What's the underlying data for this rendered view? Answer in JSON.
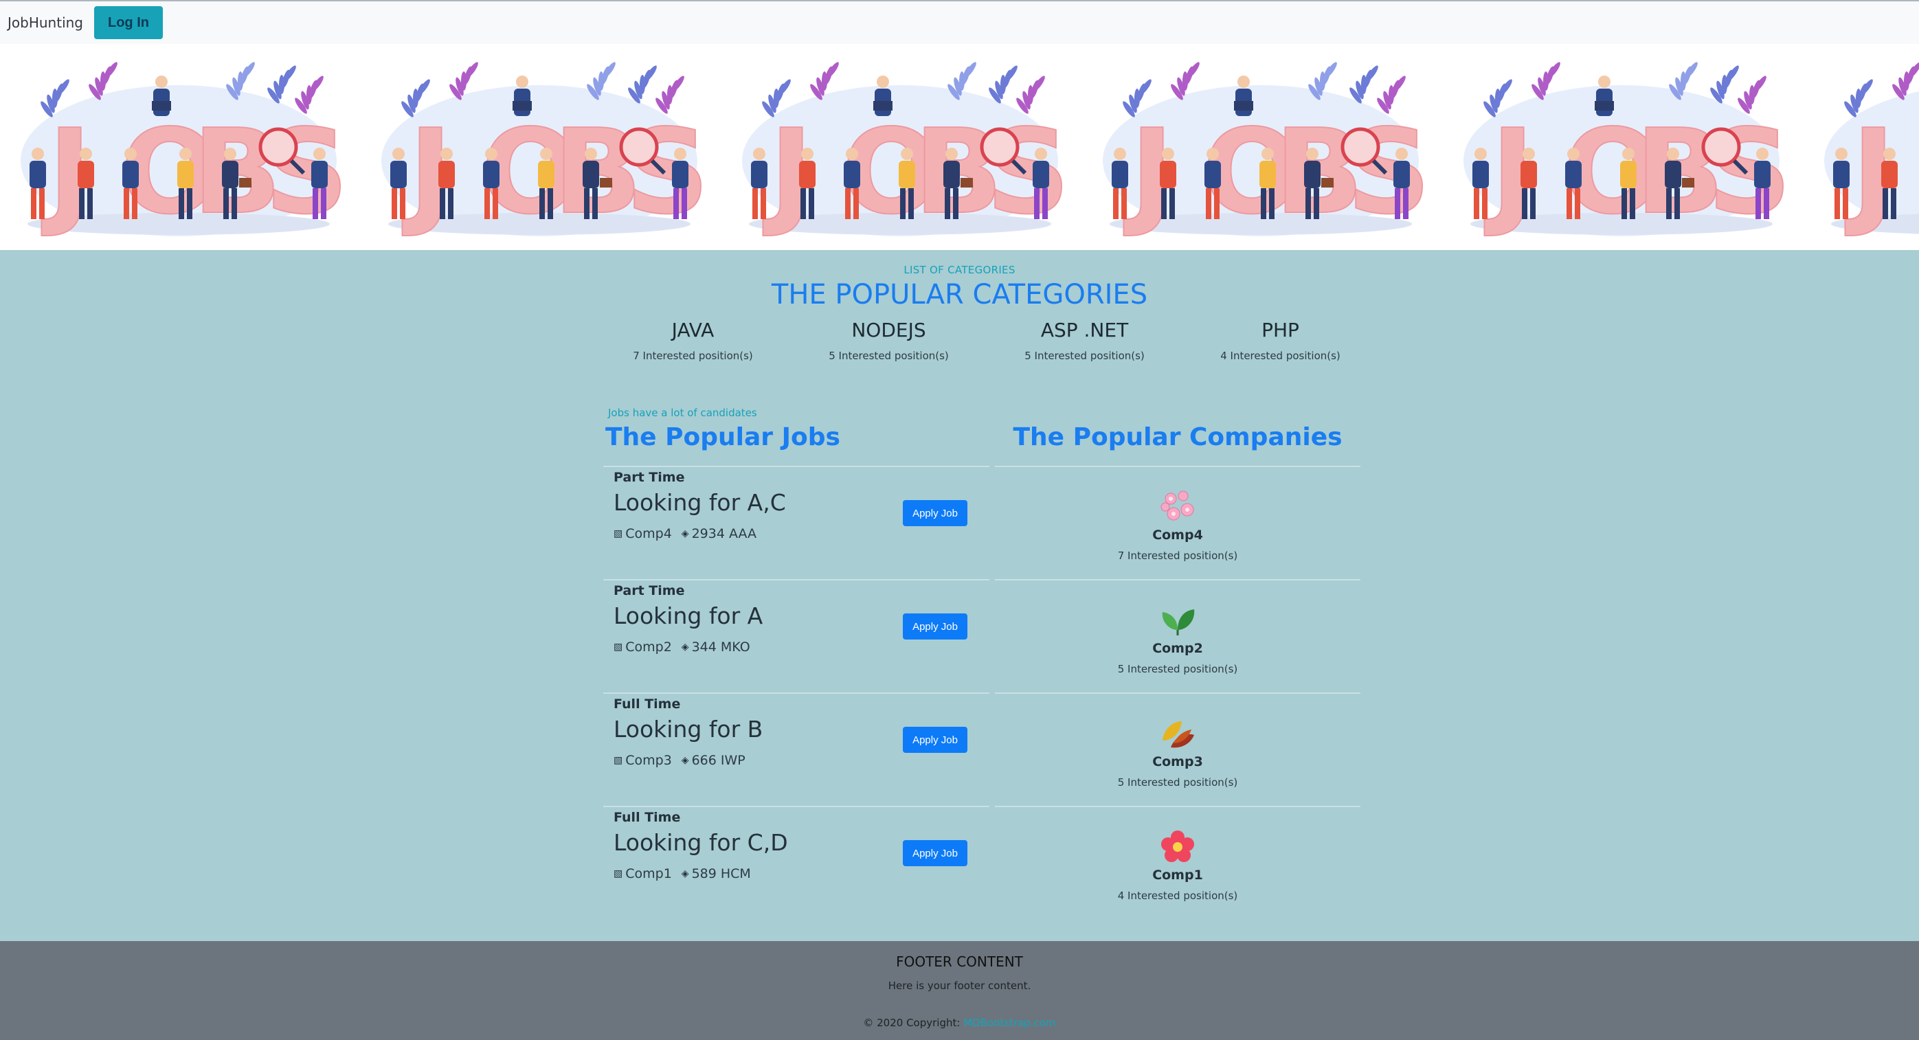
{
  "navbar": {
    "brand": "JobHunting",
    "login_label": "Log In"
  },
  "banner": {
    "word": "JOBS",
    "tile_count": 6
  },
  "categories": {
    "kicker": "LIST OF CATEGORIES",
    "title": "THE POPULAR CATEGORIES",
    "items": [
      {
        "name": "JAVA",
        "count": "7 Interested position(s)"
      },
      {
        "name": "NODEJS",
        "count": "5 Interested position(s)"
      },
      {
        "name": "ASP .NET",
        "count": "5 Interested position(s)"
      },
      {
        "name": "PHP",
        "count": "4 Interested position(s)"
      }
    ]
  },
  "jobs": {
    "kicker": "Jobs have a lot of candidates",
    "title": "The Popular Jobs",
    "apply_label": "Apply Job",
    "items": [
      {
        "type": "Part Time",
        "title": "Looking for A,C",
        "company": "Comp4",
        "location": "2934 AAA"
      },
      {
        "type": "Part Time",
        "title": "Looking for A",
        "company": "Comp2",
        "location": "344 MKO"
      },
      {
        "type": "Full Time",
        "title": "Looking for B",
        "company": "Comp3",
        "location": "666 IWP"
      },
      {
        "type": "Full Time",
        "title": "Looking for C,D",
        "company": "Comp1",
        "location": "589 HCM"
      }
    ]
  },
  "companies": {
    "title": "The Popular Companies",
    "items": [
      {
        "name": "Comp4",
        "count": "7 Interested position(s)",
        "logo": "pink-blossom-icon"
      },
      {
        "name": "Comp2",
        "count": "5 Interested position(s)",
        "logo": "green-leaves-icon"
      },
      {
        "name": "Comp3",
        "count": "5 Interested position(s)",
        "logo": "autumn-leaves-icon"
      },
      {
        "name": "Comp1",
        "count": "4 Interested position(s)",
        "logo": "red-flower-icon"
      }
    ]
  },
  "footer": {
    "title": "FOOTER CONTENT",
    "text": "Here is your footer content.",
    "copyright": "© 2020 Copyright:",
    "link": "MDBootstrap.com"
  },
  "colors": {
    "accent": "#1a7df0",
    "info": "#17a2b8",
    "main_bg": "#a8cdd3",
    "footer_bg": "#6c757d"
  }
}
